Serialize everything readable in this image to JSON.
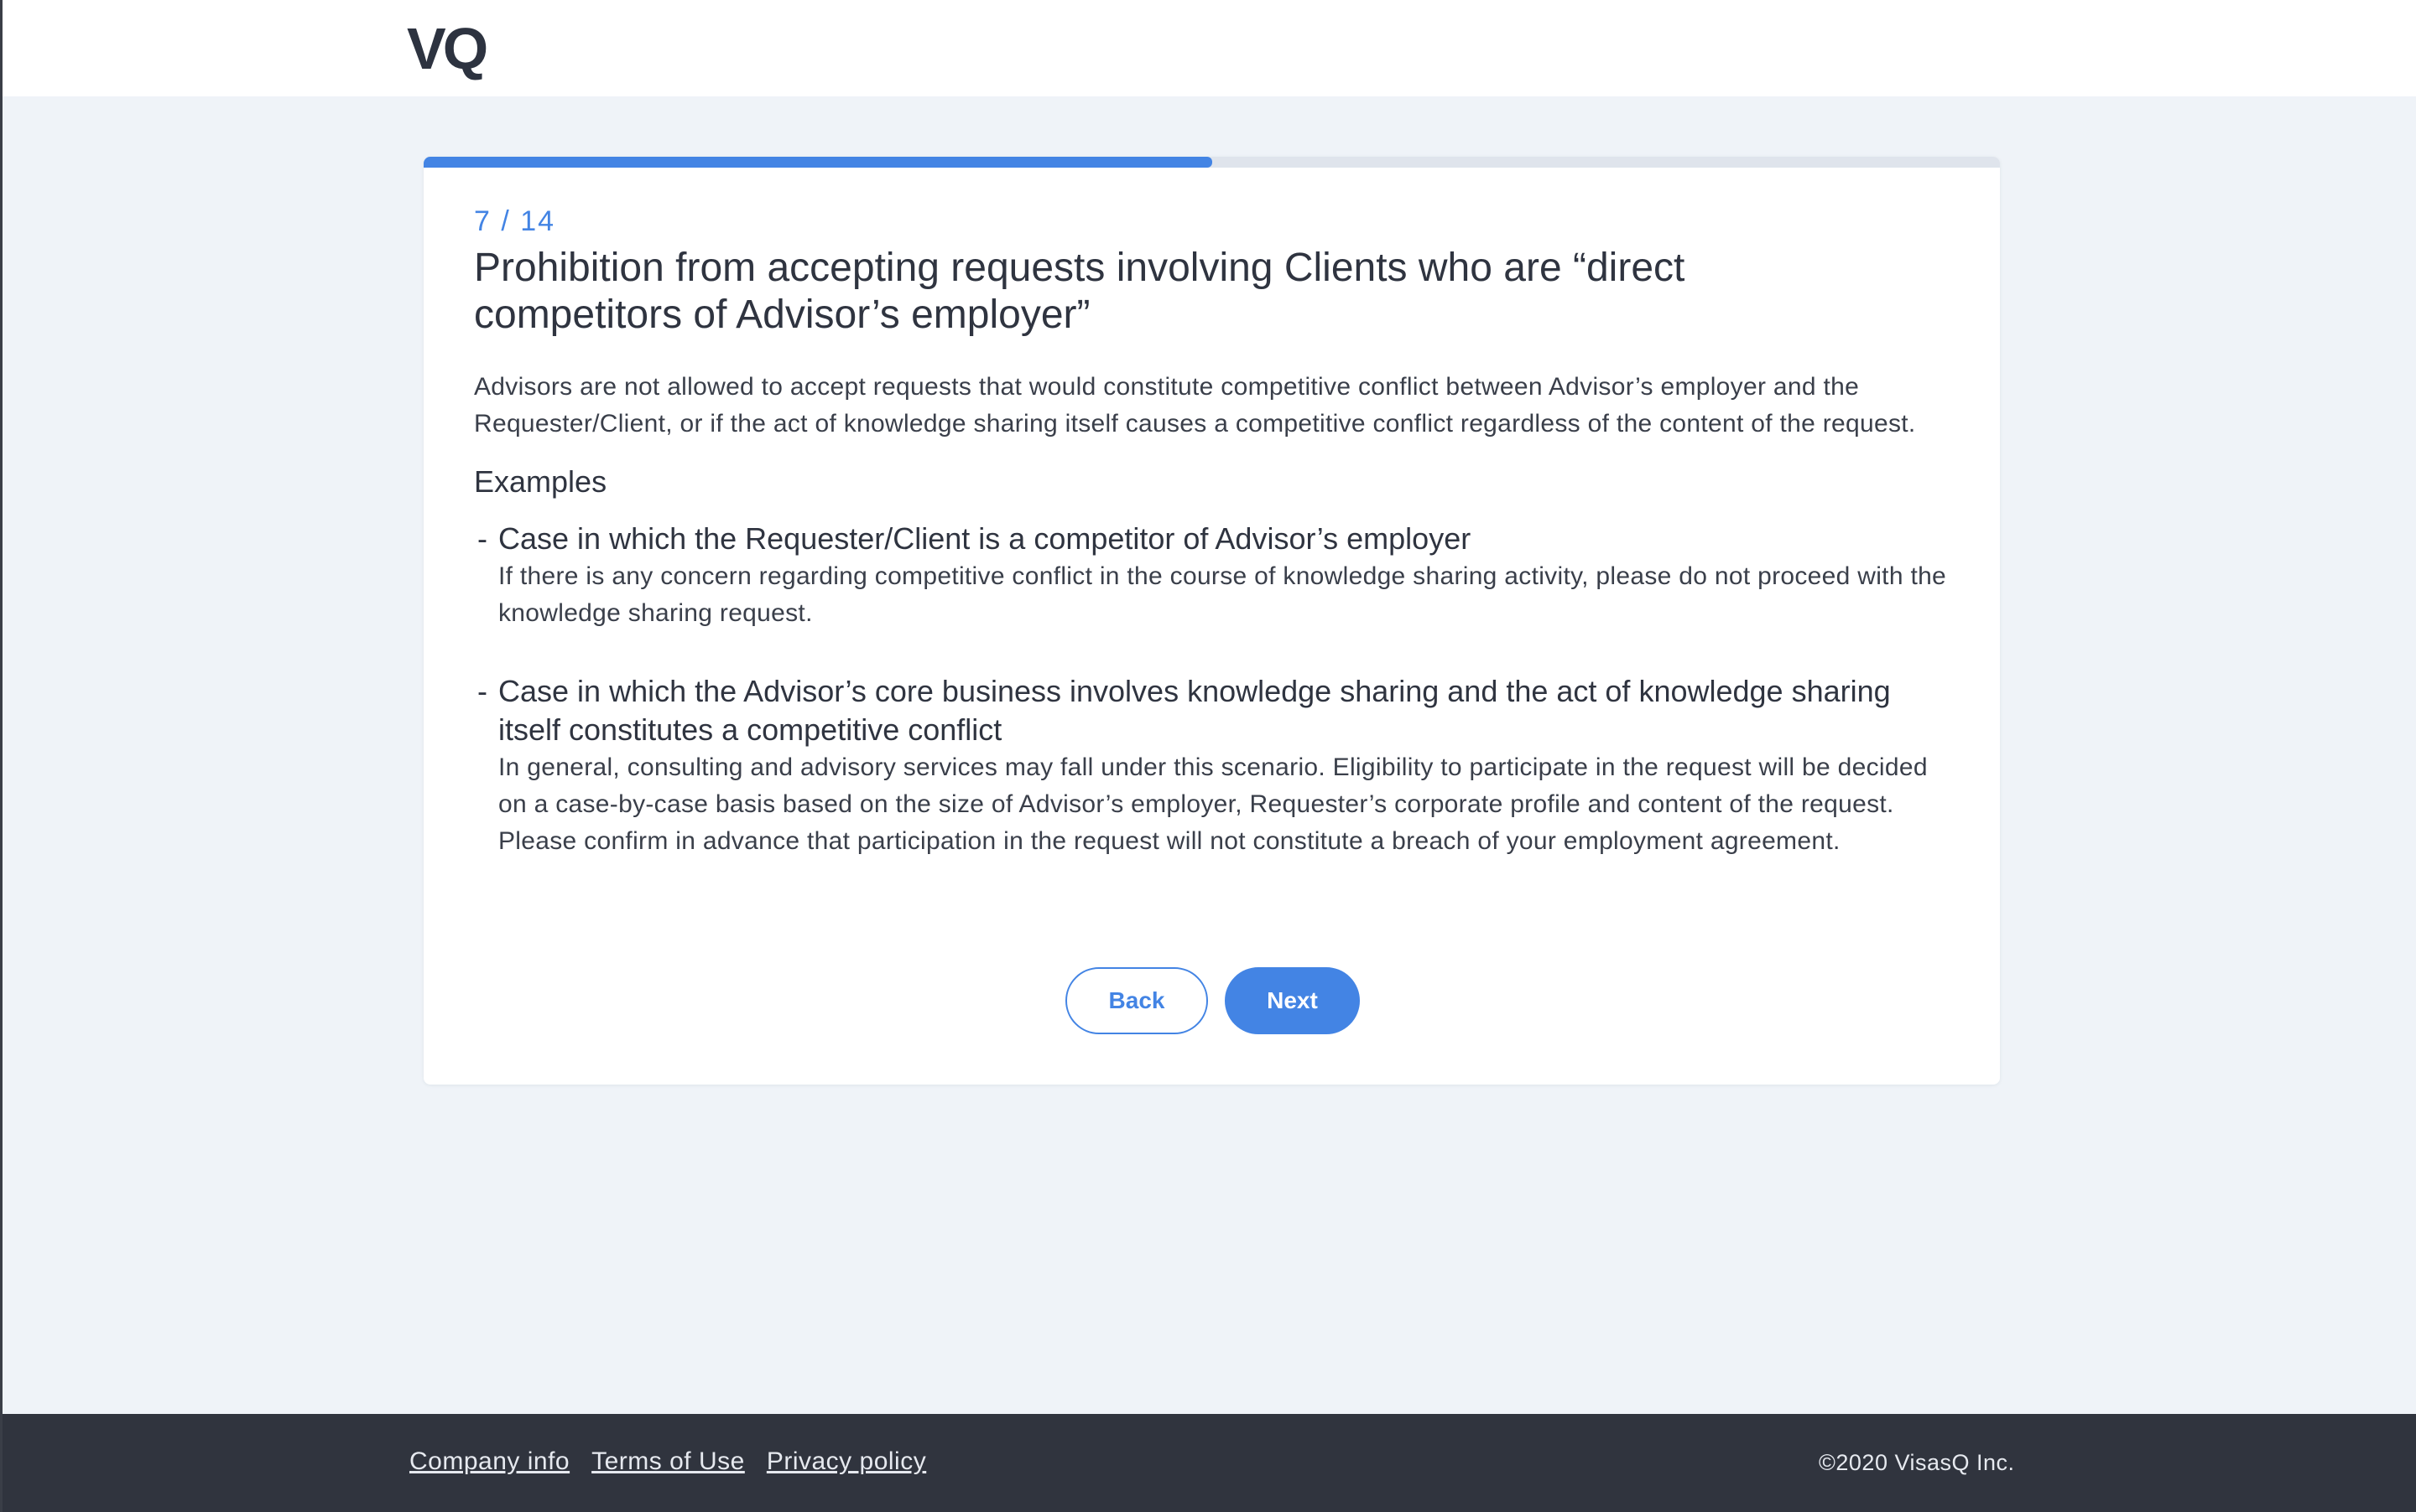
{
  "header": {
    "logo_text": "VQ"
  },
  "progress": {
    "current": 7,
    "total": 14,
    "fraction": 0.5
  },
  "card": {
    "step_label": "7 / 14",
    "title": "Prohibition from accepting requests involving Clients who are “direct competitors of Advisor’s employer”",
    "description": "Advisors are not allowed to accept requests that would constitute competitive conflict between Advisor’s employer and the Requester/Client, or if the act of knowledge sharing itself causes a competitive conflict regardless of the content of the request.",
    "examples_heading": "Examples",
    "cases": [
      {
        "dash": "-",
        "title": "Case in which the Requester/Client is a competitor of Advisor’s employer",
        "body": "If there is any concern regarding competitive conflict in the course of knowledge sharing activity, please do not proceed with the knowledge sharing request."
      },
      {
        "dash": "-",
        "title": "Case in which the Advisor’s core business involves knowledge sharing and the act of knowledge sharing itself constitutes a competitive conflict",
        "body": "In general, consulting and advisory services may fall under this scenario. Eligibility to participate in the request will be decided on a case-by-case basis based on the size of Advisor’s employer, Requester’s corporate profile and content of the request. Please confirm in advance that participation in the request will not constitute a breach of your employment agreement."
      }
    ],
    "back_label": "Back",
    "next_label": "Next"
  },
  "footer": {
    "links": [
      "Company info",
      "Terms of Use",
      "Privacy policy"
    ],
    "copyright": "©2020 VisasQ Inc."
  },
  "colors": {
    "accent": "#4384e4",
    "background": "#eff3f8",
    "footer": "#30343e",
    "text": "#2f3440"
  }
}
